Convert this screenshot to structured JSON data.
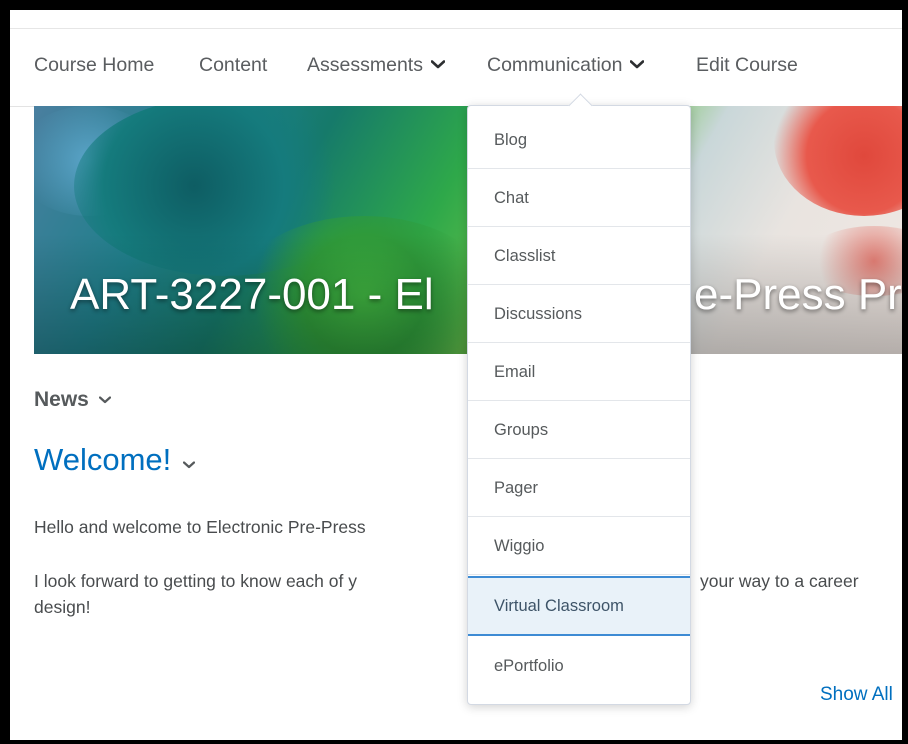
{
  "navbar": {
    "items": [
      {
        "label": "Course Home",
        "has_dropdown": false
      },
      {
        "label": "Content",
        "has_dropdown": false
      },
      {
        "label": "Assessments",
        "has_dropdown": true
      },
      {
        "label": "Communication",
        "has_dropdown": true
      },
      {
        "label": "Edit Course",
        "has_dropdown": false
      }
    ]
  },
  "banner": {
    "title_left": "ART-3227-001 - El",
    "title_right": "e-Press Pr"
  },
  "news": {
    "heading": "News",
    "item_title": "Welcome!",
    "paragraph1": "Hello and welcome to Electronic Pre-Press",
    "paragraph2_line1_left": "I look forward to getting to know each of y",
    "paragraph2_line1_right": "your way to a career",
    "paragraph2_line2": "design!",
    "show_all": "Show All"
  },
  "communication_menu": {
    "items": [
      {
        "label": "Blog"
      },
      {
        "label": "Chat"
      },
      {
        "label": "Classlist"
      },
      {
        "label": "Discussions"
      },
      {
        "label": "Email"
      },
      {
        "label": "Groups"
      },
      {
        "label": "Pager"
      },
      {
        "label": "Wiggio"
      },
      {
        "label": "Virtual Classroom",
        "highlighted": true
      },
      {
        "label": "ePortfolio"
      }
    ]
  },
  "colors": {
    "link": "#006fbf",
    "text": "#494c4e",
    "highlight_bg": "#e9f2f9",
    "highlight_border": "#3d8bd4"
  }
}
